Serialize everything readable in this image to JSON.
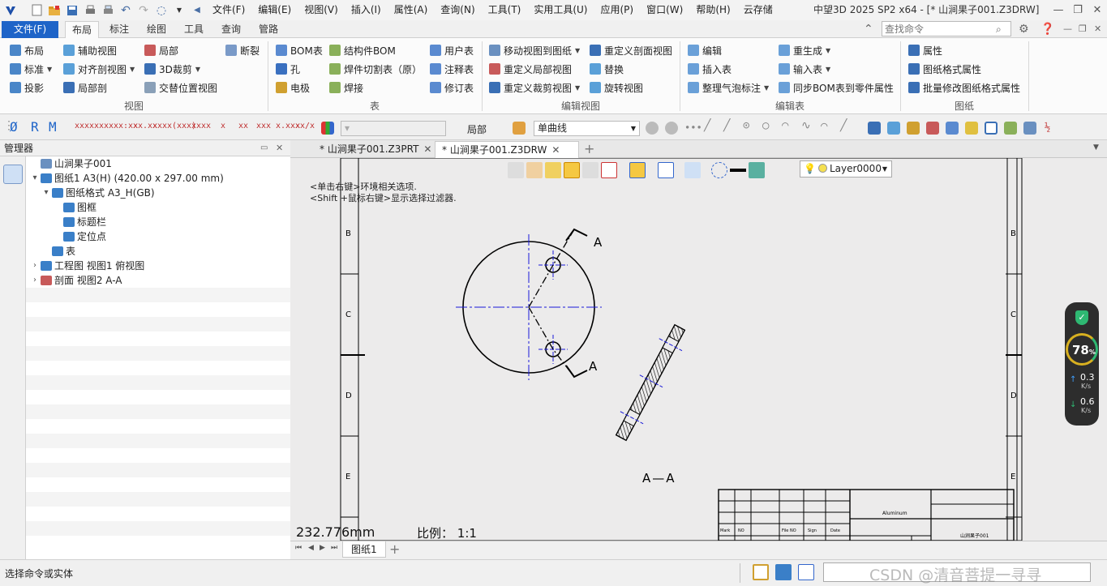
{
  "titlebar": {
    "title": "中望3D 2025 SP2 x64 - [* 山涧果子001.Z3DRW]",
    "menu": [
      "文件(F)",
      "编辑(E)",
      "视图(V)",
      "插入(I)",
      "属性(A)",
      "查询(N)",
      "工具(T)",
      "实用工具(U)",
      "应用(P)",
      "窗口(W)",
      "帮助(H)",
      "云存储"
    ]
  },
  "ribbon_tabs": [
    "文件(F)",
    "布局",
    "标注",
    "绘图",
    "工具",
    "查询",
    "管路"
  ],
  "search_placeholder": "查找命令",
  "ribbon": {
    "view": {
      "label": "视图",
      "items": [
        "布局",
        "辅助视图",
        "局部",
        "断裂",
        "标准",
        "对齐剖视图",
        "3D裁剪",
        "投影",
        "局部剖",
        "交替位置视图"
      ]
    },
    "table": {
      "label": "表",
      "items": [
        "BOM表",
        "结构件BOM",
        "用户表",
        "孔",
        "焊件切割表（原）",
        "注释表",
        "电极",
        "焊接",
        "修订表"
      ]
    },
    "edit_view": {
      "label": "编辑视图",
      "items": [
        "移动视图到图纸",
        "重定义剖面视图",
        "重定义局部视图",
        "替换",
        "重定义裁剪视图",
        "旋转视图"
      ]
    },
    "edit_table": {
      "label": "编辑表",
      "items": [
        "编辑",
        "重生成",
        "插入表",
        "输入表",
        "整理气泡标注",
        "同步BOM表到零件属性"
      ]
    },
    "sheet": {
      "label": "图纸",
      "items": [
        "属性",
        "图纸格式属性",
        "批量修改图纸格式属性"
      ]
    }
  },
  "toolbar2": {
    "filter_label": "局部",
    "curve_combo": "单曲线",
    "marks": [
      "xxxx",
      "xxxx",
      "xx:xx",
      "xx.xx",
      "xxxx",
      "(xxx)",
      "xxxx",
      "x",
      "xx",
      "xxx",
      "x.xxx",
      "xx/x"
    ]
  },
  "manager": {
    "title": "管理器",
    "tree": [
      {
        "text": "山涧果子001",
        "level": 0,
        "twisty": ""
      },
      {
        "text": "图纸1 A3(H) (420.00 x 297.00 mm)",
        "level": 0,
        "twisty": "▾"
      },
      {
        "text": "图纸格式 A3_H(GB)",
        "level": 1,
        "twisty": "▾"
      },
      {
        "text": "图框",
        "level": 2,
        "twisty": ""
      },
      {
        "text": "标题栏",
        "level": 2,
        "twisty": ""
      },
      {
        "text": "定位点",
        "level": 2,
        "twisty": ""
      },
      {
        "text": "表",
        "level": 1,
        "twisty": ""
      },
      {
        "text": "工程图 视图1 俯视图",
        "level": 0,
        "twisty": "›"
      },
      {
        "text": "剖面 视图2 A-A",
        "level": 0,
        "twisty": "›"
      }
    ]
  },
  "doc_tabs": [
    {
      "label": "* 山涧果子001.Z3PRT",
      "active": false
    },
    {
      "label": "* 山涧果子001.Z3DRW",
      "active": true
    }
  ],
  "canvas": {
    "hint1": "<单击右键>环境相关选项.",
    "hint2": "<Shift +鼠标右键>显示选择过滤器.",
    "layer": "Layer0000",
    "measure": "232.776mm",
    "scale_label": "比例：",
    "scale_value": "1:1",
    "section_label": "A",
    "section_view_label": "A—A",
    "zone_letters": [
      "B",
      "C",
      "D",
      "E"
    ],
    "title_block": {
      "material": "Aluminum",
      "partno": "山涧果子001",
      "headers": [
        "Mark",
        "NO",
        "File NO",
        "Sign",
        "Date"
      ]
    }
  },
  "sheet_tabs": {
    "active": "图纸1"
  },
  "status": {
    "text": "选择命令或实体",
    "watermark": "CSDN @清音菩提一寻寻"
  },
  "net_widget": {
    "percent": "78",
    "percent_unit": "%",
    "up": "0.3",
    "down": "0.6",
    "unit": "K/s"
  },
  "colors": {
    "accent": "#1e64c8",
    "center_line": "#1a1ad8"
  }
}
